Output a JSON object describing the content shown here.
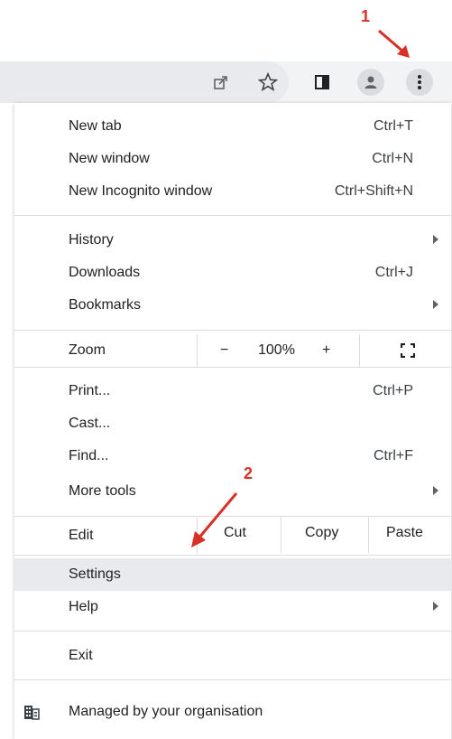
{
  "annotations": {
    "step1": "1",
    "step2": "2"
  },
  "toolbar": {
    "icons": [
      "share-icon",
      "star-icon",
      "side-panel-icon",
      "profile-icon",
      "menu-kebab-icon"
    ]
  },
  "menu": {
    "new_tab": {
      "label": "New tab",
      "shortcut": "Ctrl+T"
    },
    "new_window": {
      "label": "New window",
      "shortcut": "Ctrl+N"
    },
    "new_incognito": {
      "label": "New Incognito window",
      "shortcut": "Ctrl+Shift+N"
    },
    "history": {
      "label": "History"
    },
    "downloads": {
      "label": "Downloads",
      "shortcut": "Ctrl+J"
    },
    "bookmarks": {
      "label": "Bookmarks"
    },
    "zoom": {
      "label": "Zoom",
      "minus": "−",
      "value": "100%",
      "plus": "+"
    },
    "print": {
      "label": "Print...",
      "shortcut": "Ctrl+P"
    },
    "cast": {
      "label": "Cast..."
    },
    "find": {
      "label": "Find...",
      "shortcut": "Ctrl+F"
    },
    "more_tools": {
      "label": "More tools"
    },
    "edit": {
      "label": "Edit",
      "cut": "Cut",
      "copy": "Copy",
      "paste": "Paste"
    },
    "settings": {
      "label": "Settings"
    },
    "help": {
      "label": "Help"
    },
    "exit": {
      "label": "Exit"
    },
    "managed": {
      "label": "Managed by your organisation"
    }
  },
  "colors": {
    "annotation": "#d93025",
    "highlight": "#e8eaed"
  }
}
